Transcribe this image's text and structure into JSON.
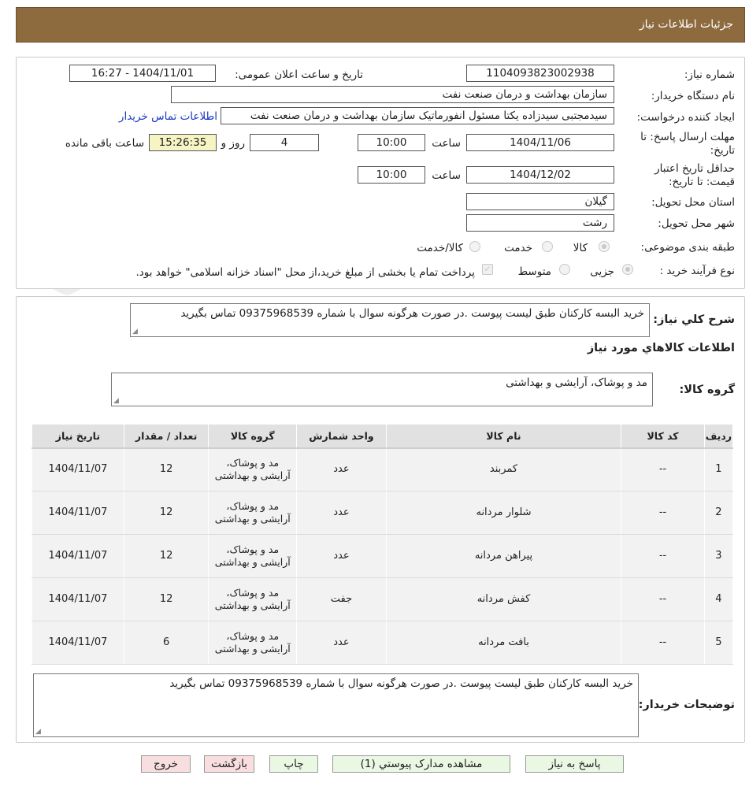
{
  "header": {
    "title": "جزئیات اطلاعات نیاز"
  },
  "watermark": {
    "text": "AriaTender.neT"
  },
  "fields": {
    "need_number_label": "شماره نیاز:",
    "need_number": "1104093823002938",
    "announce_label": "تاریخ و ساعت اعلان عمومی:",
    "announce_value": "1404/11/01 - 16:27",
    "buyer_org_label": "نام دستگاه خریدار:",
    "buyer_org": "سازمان بهداشت و درمان صنعت نفت",
    "creator_label": "ایجاد کننده درخواست:",
    "creator": "سیدمجتبی سیدزاده یکتا مسئول انفورماتیک سازمان بهداشت و درمان صنعت نفت",
    "contact_link": "اطلاعات تماس خریدار",
    "deadline_label": "مهلت ارسال پاسخ: تا تاریخ:",
    "deadline_date": "1404/11/06",
    "time_label": "ساعت",
    "deadline_time": "10:00",
    "days": "4",
    "days_label": "روز و",
    "remaining_time": "15:26:35",
    "remaining_label": "ساعت باقی مانده",
    "validity_label": "حداقل تاریخ اعتبار قیمت: تا تاریخ:",
    "validity_date": "1404/12/02",
    "validity_time": "10:00",
    "province_label": "استان محل تحویل:",
    "province": "گیلان",
    "city_label": "شهر محل تحویل:",
    "city": "رشت",
    "category_label": "طبقه بندی موضوعی:",
    "category_options": [
      "کالا",
      "خدمت",
      "کالا/خدمت"
    ],
    "process_label": "نوع فرآیند خرید :",
    "process_options": [
      "جزیی",
      "متوسط"
    ],
    "payment_note": "پرداخت تمام یا بخشی از مبلغ خرید،از محل \"اسناد خزانه اسلامی\" خواهد بود."
  },
  "summary": {
    "label": "شرح کلي نياز:",
    "text": "خرید البسه کارکنان طبق لیست پیوست .در صورت هرگونه سوال با شماره 09375968539 تماس بگیرید"
  },
  "goods_info": {
    "title": "اطلاعات کالاهاي مورد نياز",
    "group_label": "گروه کالا:",
    "group_value": "مد و پوشاک، آرایشی و بهداشتی"
  },
  "table": {
    "headers": [
      "ردیف",
      "کد کالا",
      "نام کالا",
      "واحد شمارش",
      "گروه کالا",
      "تعداد / مقدار",
      "تاریخ نیاز"
    ],
    "rows": [
      [
        "1",
        "--",
        "کمربند",
        "عدد",
        "مد و پوشاک، آرایشی و بهداشتی",
        "12",
        "1404/11/07"
      ],
      [
        "2",
        "--",
        "شلوار مردانه",
        "عدد",
        "مد و پوشاک، آرایشی و بهداشتی",
        "12",
        "1404/11/07"
      ],
      [
        "3",
        "--",
        "پیراهن مردانه",
        "عدد",
        "مد و پوشاک، آرایشی و بهداشتی",
        "12",
        "1404/11/07"
      ],
      [
        "4",
        "--",
        "کفش مردانه",
        "جفت",
        "مد و پوشاک، آرایشی و بهداشتی",
        "12",
        "1404/11/07"
      ],
      [
        "5",
        "--",
        "بافت مردانه",
        "عدد",
        "مد و پوشاک، آرایشی و بهداشتی",
        "6",
        "1404/11/07"
      ]
    ]
  },
  "buyer_notes": {
    "label": "توضیحات خریدار:",
    "text": "خرید البسه کارکنان طبق لیست پیوست .در صورت هرگونه سوال با شماره 09375968539 تماس بگیرید"
  },
  "buttons": {
    "reply": "پاسخ به نیاز",
    "attachments": "مشاهده مدارک پیوستي (1)",
    "print": "چاپ",
    "back": "بازگشت",
    "exit": "خروج"
  },
  "colors": {
    "header_bg": "#8e6a3f",
    "link": "#1a38c5",
    "timer_bg": "#f6f4c3"
  }
}
